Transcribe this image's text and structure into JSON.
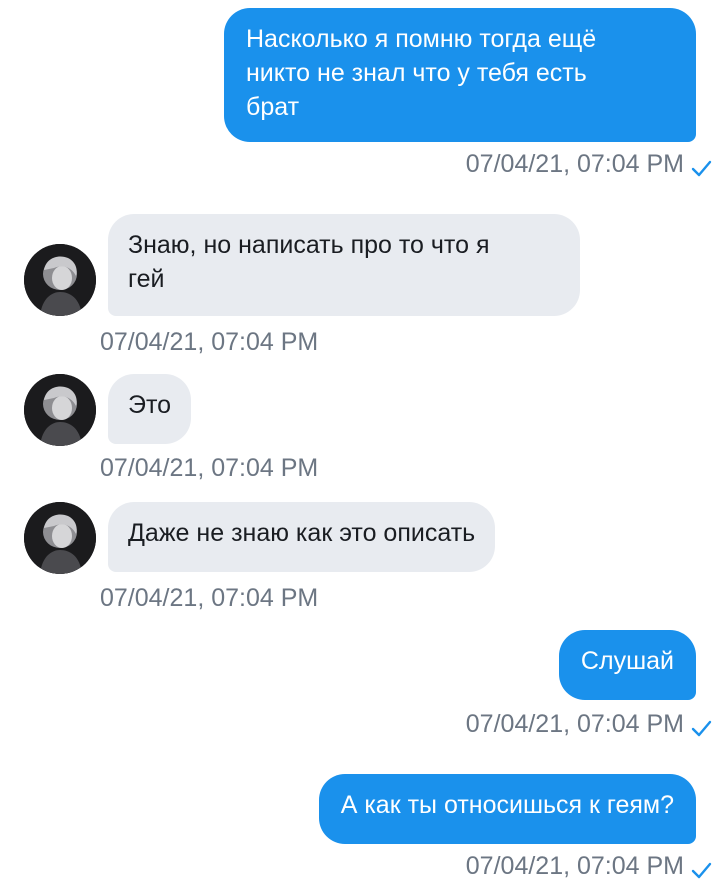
{
  "colors": {
    "outgoing_bubble": "#1a91ec",
    "incoming_bubble": "#e8ebf0",
    "timestamp": "#6c7683",
    "read_check": "#1a91ec"
  },
  "messages": [
    {
      "direction": "outgoing",
      "text": "Насколько я помню тогда ещё\nникто не знал что у тебя есть\nбрат",
      "timestamp": "07/04/21, 07:04 PM",
      "status_icon": "read-check-icon"
    },
    {
      "direction": "incoming",
      "text": "Знаю, но написать про то что я\nгей",
      "timestamp": "07/04/21, 07:04 PM",
      "avatar": "avatar-icon"
    },
    {
      "direction": "incoming",
      "text": "Это",
      "timestamp": "07/04/21, 07:04 PM",
      "avatar": "avatar-icon"
    },
    {
      "direction": "incoming",
      "text": "Даже не знаю как это описать",
      "timestamp": "07/04/21, 07:04 PM",
      "avatar": "avatar-icon"
    },
    {
      "direction": "outgoing",
      "text": "Слушай",
      "timestamp": "07/04/21, 07:04 PM",
      "status_icon": "read-check-icon"
    },
    {
      "direction": "outgoing",
      "text": "А как ты относишься к геям?",
      "timestamp": "07/04/21, 07:04 PM",
      "status_icon": "read-check-icon"
    }
  ]
}
